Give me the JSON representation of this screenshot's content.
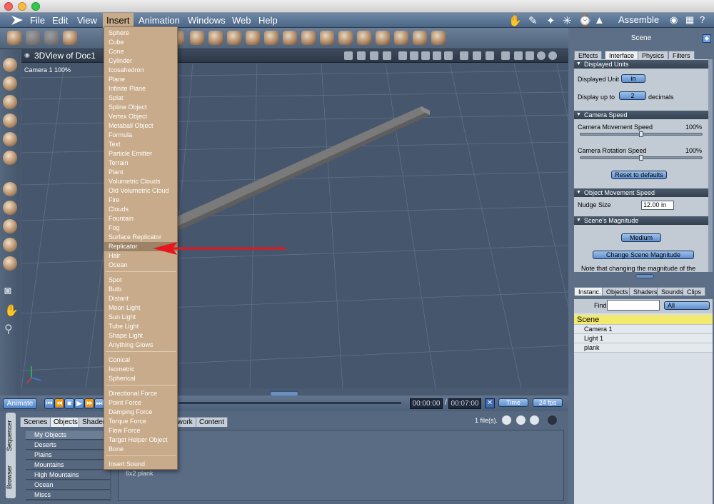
{
  "app": {
    "mode": "Assemble"
  },
  "menubar": {
    "items": [
      "File",
      "Edit",
      "View",
      "Insert",
      "Animation",
      "Windows",
      "Web",
      "Help"
    ],
    "active": "Insert"
  },
  "viewport": {
    "title": "3DView of Doc1",
    "camera_label": "Camera 1 100%"
  },
  "insert_menu": {
    "group1": [
      "Sphere",
      "Cube",
      "Cone",
      "Cylinder",
      "Icosahedron",
      "Plane",
      "Infinite Plane",
      "Splat",
      "Spline Object",
      "Vertex Object",
      "Metaball Object",
      "Formula",
      "Text",
      "Particle Emitter",
      "Terrain",
      "Plant",
      "Volumetric Clouds",
      "Old Volumetric Cloud",
      "Fire",
      "Clouds",
      "Fountain",
      "Fog",
      "Surface Replicator",
      "Replicator",
      "Hair",
      "Ocean"
    ],
    "group2": [
      "Spot",
      "Bulb",
      "Distant",
      "Moon Light",
      "Sun Light",
      "Tube Light",
      "Shape Light",
      "Anything Glows"
    ],
    "group3": [
      "Conical",
      "Isometric",
      "Spherical"
    ],
    "group4": [
      "Directional Force",
      "Point Force",
      "Damping Force",
      "Torque Force",
      "Flow Force",
      "Target Helper Object",
      "Bone"
    ],
    "group5": [
      "Insert Sound"
    ],
    "highlighted": "Replicator"
  },
  "timeline": {
    "animate_label": "Animate",
    "time_current": "00:00:00",
    "time_end": "00:07:00",
    "time_mode": "Time",
    "fps": "24 fps",
    "slash": "/"
  },
  "browser": {
    "side_tabs": [
      "Sequencer",
      "Browser"
    ],
    "tabs": [
      "Scenes",
      "Objects",
      "Shaders",
      "Network",
      "Content"
    ],
    "categories": [
      "My Objects",
      "Deserts",
      "Plains",
      "Mountains",
      "High Mountains",
      "Ocean",
      "Miscs"
    ],
    "file_count": "1 file(s).",
    "file_name": "6x2 plank"
  },
  "right_panel": {
    "title": "Scene",
    "tabs": [
      "Effects",
      "Interface",
      "Physics",
      "Filters"
    ],
    "sections": {
      "units_head": "Displayed Units",
      "units_label": "Displayed Unit",
      "units_value": "in",
      "display_up_to": "Display up to",
      "decimals_value": "2",
      "decimals_label": "decimals",
      "camera_head": "Camera Speed",
      "cam_move_label": "Camera Movement Speed",
      "cam_move_pct": "100%",
      "cam_move_level": 0.5,
      "cam_rot_label": "Camera Rotation Speed",
      "cam_rot_pct": "100%",
      "cam_rot_level": 0.5,
      "reset_label": "Reset to defaults",
      "object_head": "Object Movement Speed",
      "nudge_label": "Nudge Size",
      "nudge_value": "12.00 in",
      "magnitude_head": "Scene's Magnitude",
      "magnitude_value": "Medium",
      "change_mag_label": "Change Scene Magnitude",
      "note": "Note that changing the magnitude of the"
    },
    "instance_tabs": [
      "Instanc.",
      "Objects",
      "Shaders",
      "Sounds",
      "Clips"
    ],
    "find_label": "Find:",
    "find_filter": "All",
    "scene_root": "Scene",
    "instances": [
      "Camera 1",
      "Light 1",
      "plank"
    ]
  },
  "colors": {
    "menu_bg": "#c8ab8a",
    "highlight": "#9c8267",
    "accent_blue": "#4f82c6",
    "arrow": "#e8141e"
  }
}
